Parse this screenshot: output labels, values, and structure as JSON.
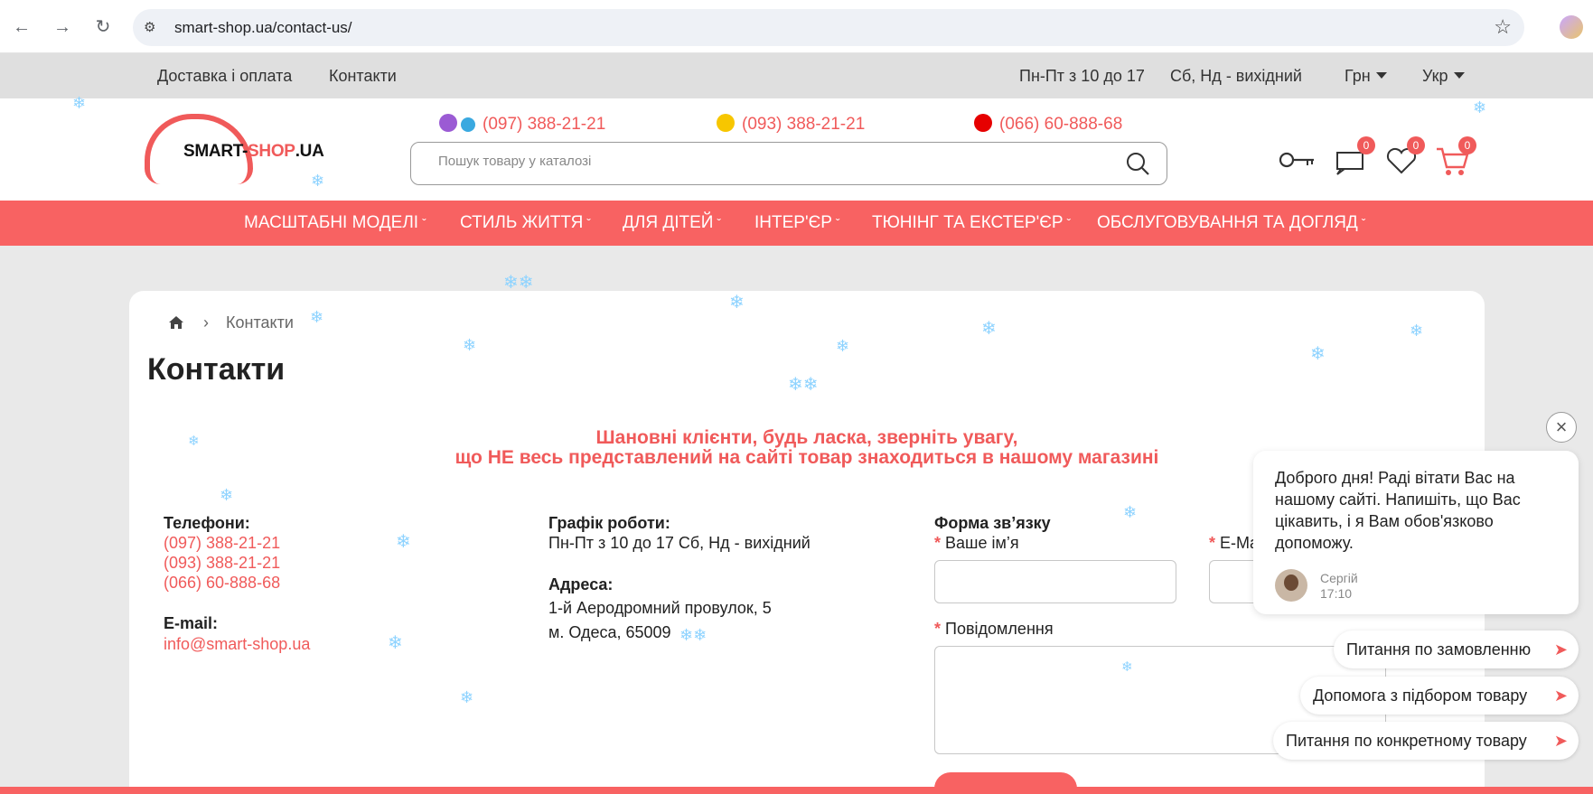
{
  "browser": {
    "url": "smart-shop.ua/contact-us/"
  },
  "topbar": {
    "links": [
      "Доставка і оплата",
      "Контакти"
    ],
    "hours_weekday": "Пн-Пт з 10 до 17",
    "hours_weekend": "Сб, Нд - вихідний",
    "currency": "Грн",
    "language": "Укр"
  },
  "header": {
    "logo_text_main": "SMART-",
    "logo_text_accent": "SHOP",
    "logo_text_suffix": ".UA",
    "phones": [
      "(097) 388-21-21",
      "(093) 388-21-21",
      "(066) 60-888-68"
    ],
    "search_placeholder": "Пошук товару у каталозі",
    "compare_count": "0",
    "wishlist_count": "0",
    "cart_count": "0"
  },
  "menu": {
    "items": [
      "МАСШТАБНІ МОДЕЛІ",
      "СТИЛЬ ЖИТТЯ",
      "ДЛЯ ДІТЕЙ",
      "ІНТЕР'ЄР",
      "ТЮНІНГ ТА ЕКСТЕР'ЄР",
      "ОБСЛУГОВУВАННЯ ТА ДОГЛЯД"
    ]
  },
  "content": {
    "breadcrumb_current": "Контакти",
    "title": "Контакти",
    "notice_line1": "Шановні клієнти, будь ласка, зверніть увагу,",
    "notice_line2": "що НЕ весь представлений на сайті товар знаходиться в нашому магазині",
    "phones_label": "Телефони:",
    "phones": [
      "(097) 388-21-21",
      "(093) 388-21-21",
      "(066) 60-888-68"
    ],
    "email_label": "E-mail:",
    "email": "info@smart-shop.ua",
    "schedule_label": "Графік роботи:",
    "schedule": "Пн-Пт з 10 до 17 Сб, Нд - вихідний",
    "address_label": "Адреса:",
    "address_line1": "1-й Аеродромний провулок, 5",
    "address_line2": "м. Одеса, 65009",
    "form_label": "Форма зв’язку",
    "name_label": "Ваше ім’я",
    "email_field_label": "E-Ma",
    "message_label": "Повідомлення",
    "required_mark": "*"
  },
  "chat": {
    "message": "Доброго дня! Раді вітати Вас на нашому сайті. Напишіть, що Вас цікавить, і я Вам обов'язково допоможу.",
    "agent_name": "Сергій",
    "time": "17:10",
    "quick_replies": [
      "Питання по замовленню",
      "Допомога з підбором товару",
      "Питання по конкретному товару"
    ]
  },
  "colors": {
    "accent": "#f86262",
    "link": "#f05a5a"
  }
}
